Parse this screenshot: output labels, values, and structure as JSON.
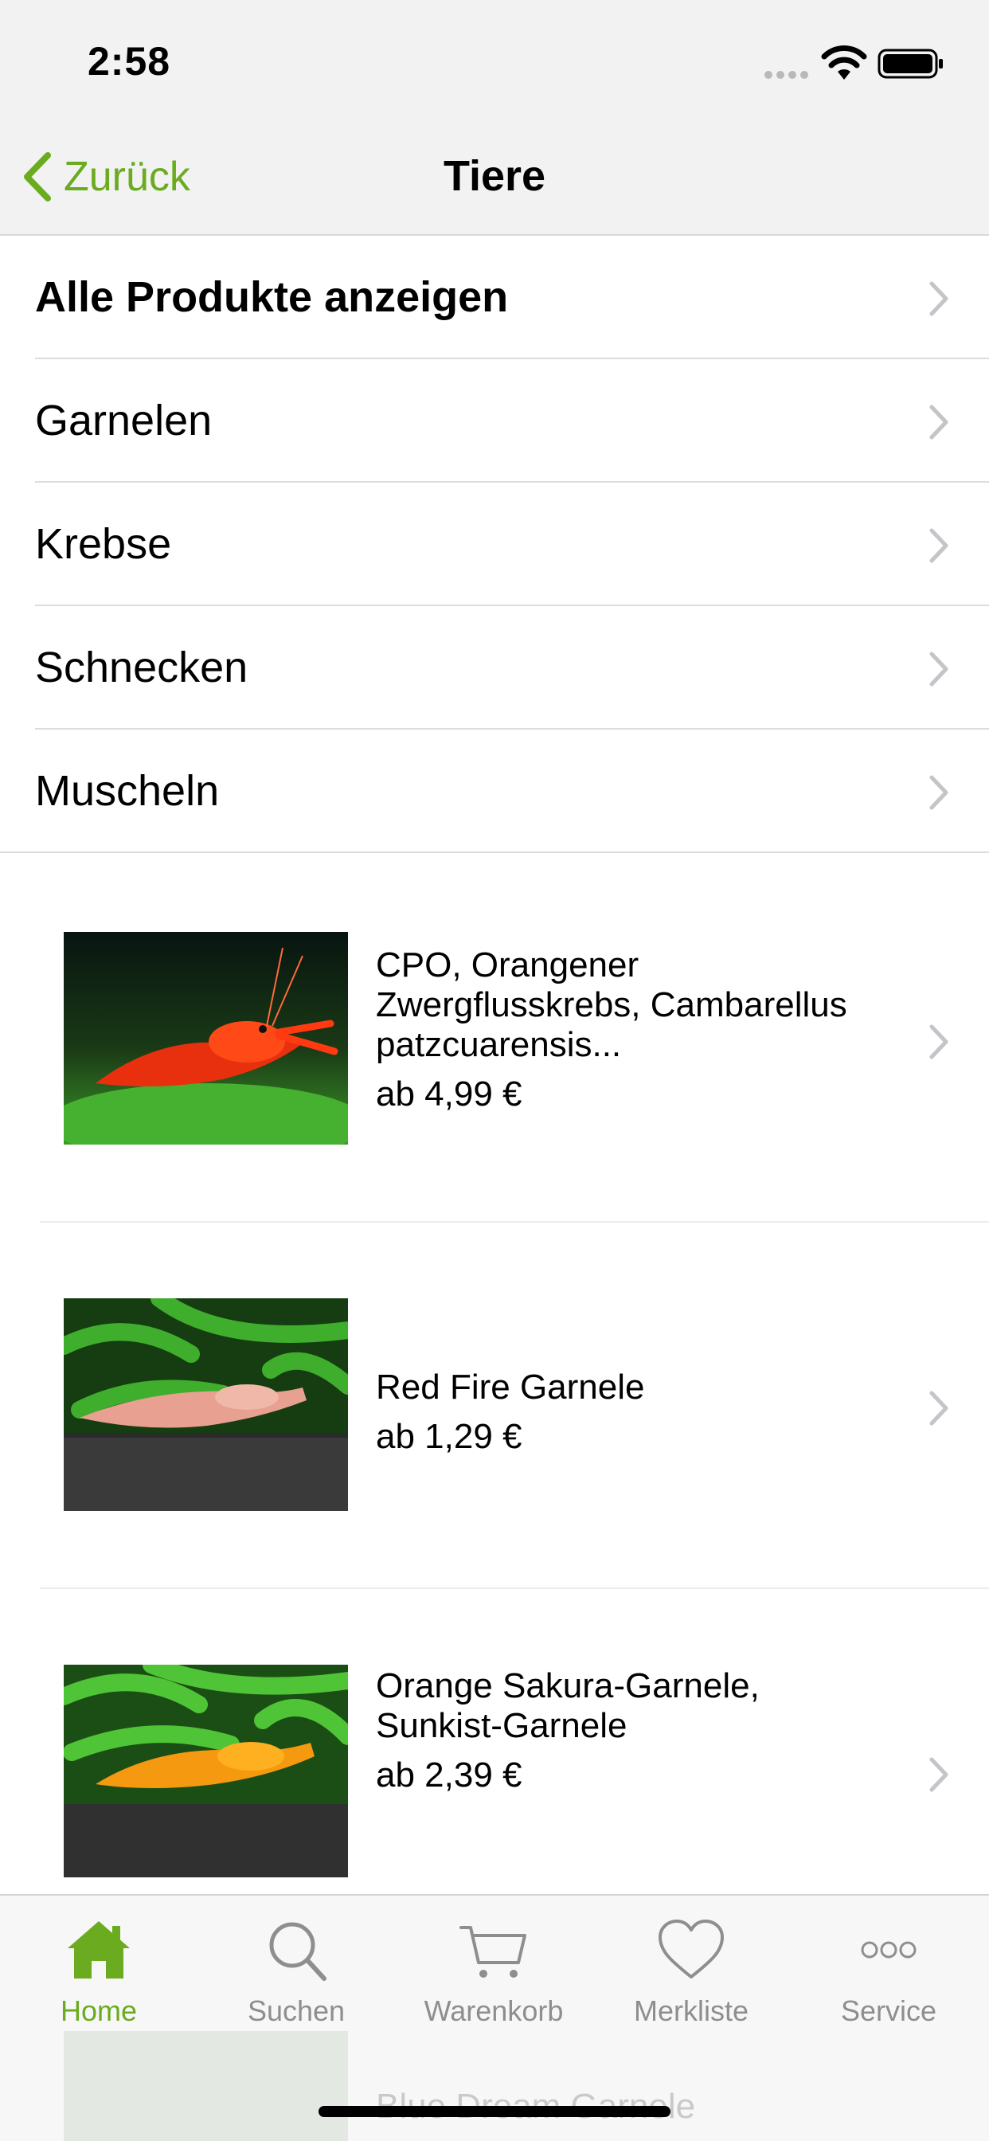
{
  "status_bar": {
    "time": "2:58"
  },
  "nav": {
    "back_label": "Zurück",
    "title": "Tiere"
  },
  "categories": [
    {
      "label": "Alle Produkte anzeigen",
      "bold": true
    },
    {
      "label": "Garnelen"
    },
    {
      "label": "Krebse"
    },
    {
      "label": "Schnecken"
    },
    {
      "label": "Muscheln"
    }
  ],
  "products": [
    {
      "name": "CPO, Orangener Zwergflusskrebs, Cambarellus patzcuarensis...",
      "price": "ab 4,99 €"
    },
    {
      "name": "Red Fire Garnele",
      "price": "ab 1,29 €"
    },
    {
      "name": "Orange Sakura-Garnele, Sunkist-Garnele",
      "price": "ab 2,39 €"
    }
  ],
  "partial_next_product": {
    "name": "Blue Dream Garnele"
  },
  "tabs": [
    {
      "label": "Home",
      "icon": "home-icon",
      "active": true
    },
    {
      "label": "Suchen",
      "icon": "search-icon"
    },
    {
      "label": "Warenkorb",
      "icon": "cart-icon"
    },
    {
      "label": "Merkliste",
      "icon": "heart-icon"
    },
    {
      "label": "Service",
      "icon": "more-icon"
    }
  ],
  "colors": {
    "accent": "#6aab1f",
    "inactive": "#8e8e8e",
    "bar_background": "#f2f2f2"
  }
}
